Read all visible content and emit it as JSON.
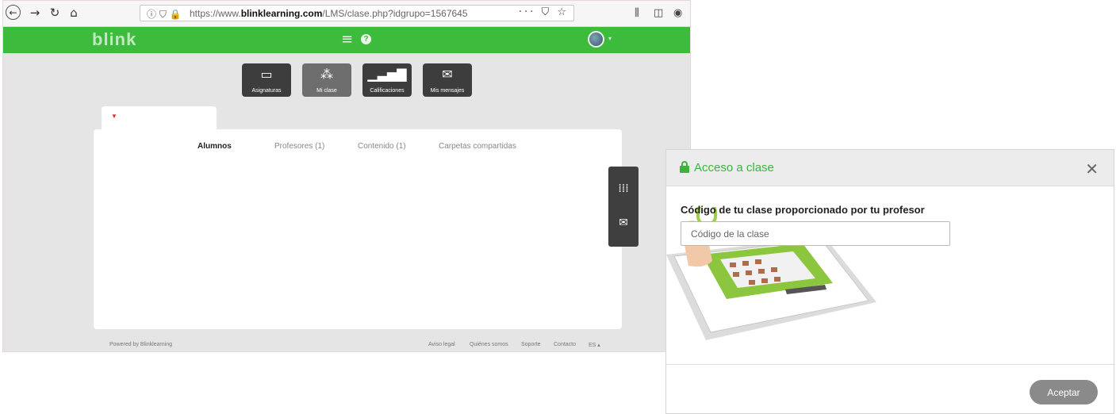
{
  "browser": {
    "url_prefix": "https://www.",
    "url_domain": "blinklearning.com",
    "url_path": "/LMS/clase.php?idgrupo=1567645",
    "more_label": "···"
  },
  "topbar": {
    "logo": "blink",
    "brand_color": "#3dbb3d"
  },
  "modules": [
    {
      "label": "Asignaturas",
      "icon": "monitor-icon"
    },
    {
      "label": "Mi clase",
      "icon": "class-icon"
    },
    {
      "label": "Calificaciones",
      "icon": "bars-icon"
    },
    {
      "label": "Mis mensajes",
      "icon": "envelope-icon"
    }
  ],
  "subtabs": [
    {
      "label": "Alumnos",
      "active": true
    },
    {
      "label": "Profesores (1)"
    },
    {
      "label": "Contenido (1)"
    },
    {
      "label": "Carpetas compartidas"
    }
  ],
  "footer": {
    "powered": "Powered by Blinklearning",
    "links": [
      "Aviso legal",
      "Quiénes somos",
      "Soporte",
      "Contacto",
      "ES ▴"
    ]
  },
  "dialog": {
    "title": "Acceso a clase",
    "label": "Código de tu clase proporcionado por tu profesor",
    "input_placeholder": "Código de la clase",
    "input_value": "",
    "accept_label": "Aceptar"
  }
}
